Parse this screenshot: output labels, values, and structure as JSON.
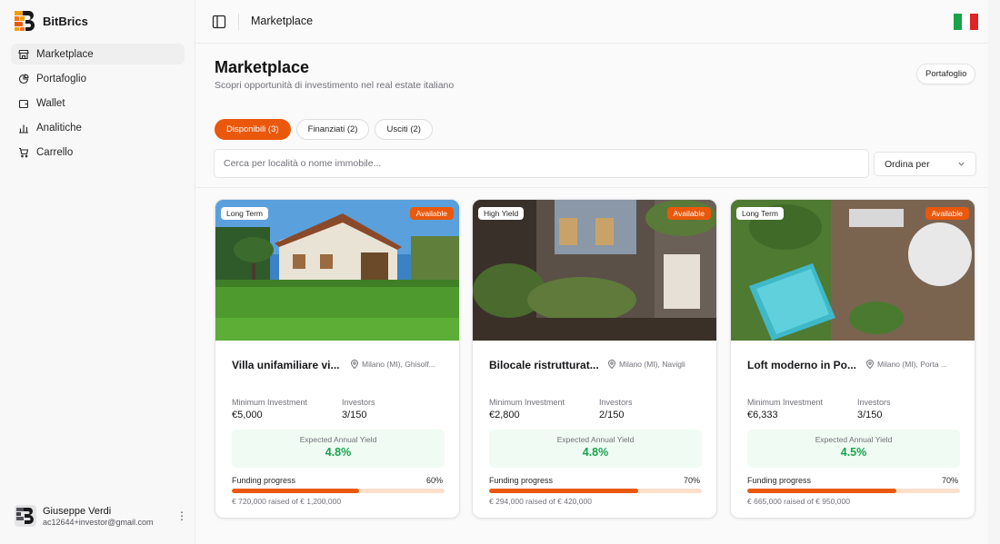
{
  "brand": {
    "name": "BitBrics"
  },
  "sidebar": {
    "items": [
      {
        "label": "Marketplace",
        "icon": "store-icon",
        "active": true
      },
      {
        "label": "Portafoglio",
        "icon": "pie-chart-icon",
        "active": false
      },
      {
        "label": "Wallet",
        "icon": "wallet-icon",
        "active": false
      },
      {
        "label": "Analitiche",
        "icon": "bar-chart-icon",
        "active": false
      },
      {
        "label": "Carrello",
        "icon": "cart-icon",
        "active": false
      }
    ],
    "user": {
      "name": "Giuseppe Verdi",
      "email": "ac12644+investor@gmail.com"
    }
  },
  "header": {
    "title": "Marketplace"
  },
  "main": {
    "title": "Marketplace",
    "subtitle": "Scopri opportunità di investimento nel real estate italiano",
    "portfolio_button": "Portafoglio",
    "tabs": [
      {
        "label": "Disponibili (3)",
        "active": true
      },
      {
        "label": "Finanziati (2)",
        "active": false
      },
      {
        "label": "Usciti (2)",
        "active": false
      }
    ],
    "search": {
      "placeholder": "Cerca per località o nome immobile..."
    },
    "sort": {
      "label": "Ordina per"
    },
    "labels": {
      "min_investment": "Minimum Investment",
      "investors": "Investors",
      "yield": "Expected Annual Yield",
      "funding": "Funding progress"
    },
    "cards": [
      {
        "tag": "Long Term",
        "status": "Available",
        "title": "Villa unifamiliare vi...",
        "location": "Milano (MI), Ghisolf...",
        "min_investment": "€5,000",
        "investors": "3/150",
        "yield": "4.8%",
        "progress_label": "60%",
        "progress": 60,
        "raised": "€ 720,000 raised of € 1,200,000"
      },
      {
        "tag": "High Yield",
        "status": "Available",
        "title": "Bilocale ristrutturat...",
        "location": "Milano (MI), Navigli",
        "min_investment": "€2,800",
        "investors": "2/150",
        "yield": "4.8%",
        "progress_label": "70%",
        "progress": 70,
        "raised": "€ 294,000 raised of € 420,000"
      },
      {
        "tag": "Long Term",
        "status": "Available",
        "title": "Loft moderno in Po...",
        "location": "Milano (MI), Porta ...",
        "min_investment": "€6,333",
        "investors": "3/150",
        "yield": "4.5%",
        "progress_label": "70%",
        "progress": 70,
        "raised": "€ 665,000 raised of € 950,000"
      }
    ]
  },
  "colors": {
    "accent": "#ea580c",
    "yield_green": "#16a34a",
    "progress_track": "#fde0cc"
  }
}
